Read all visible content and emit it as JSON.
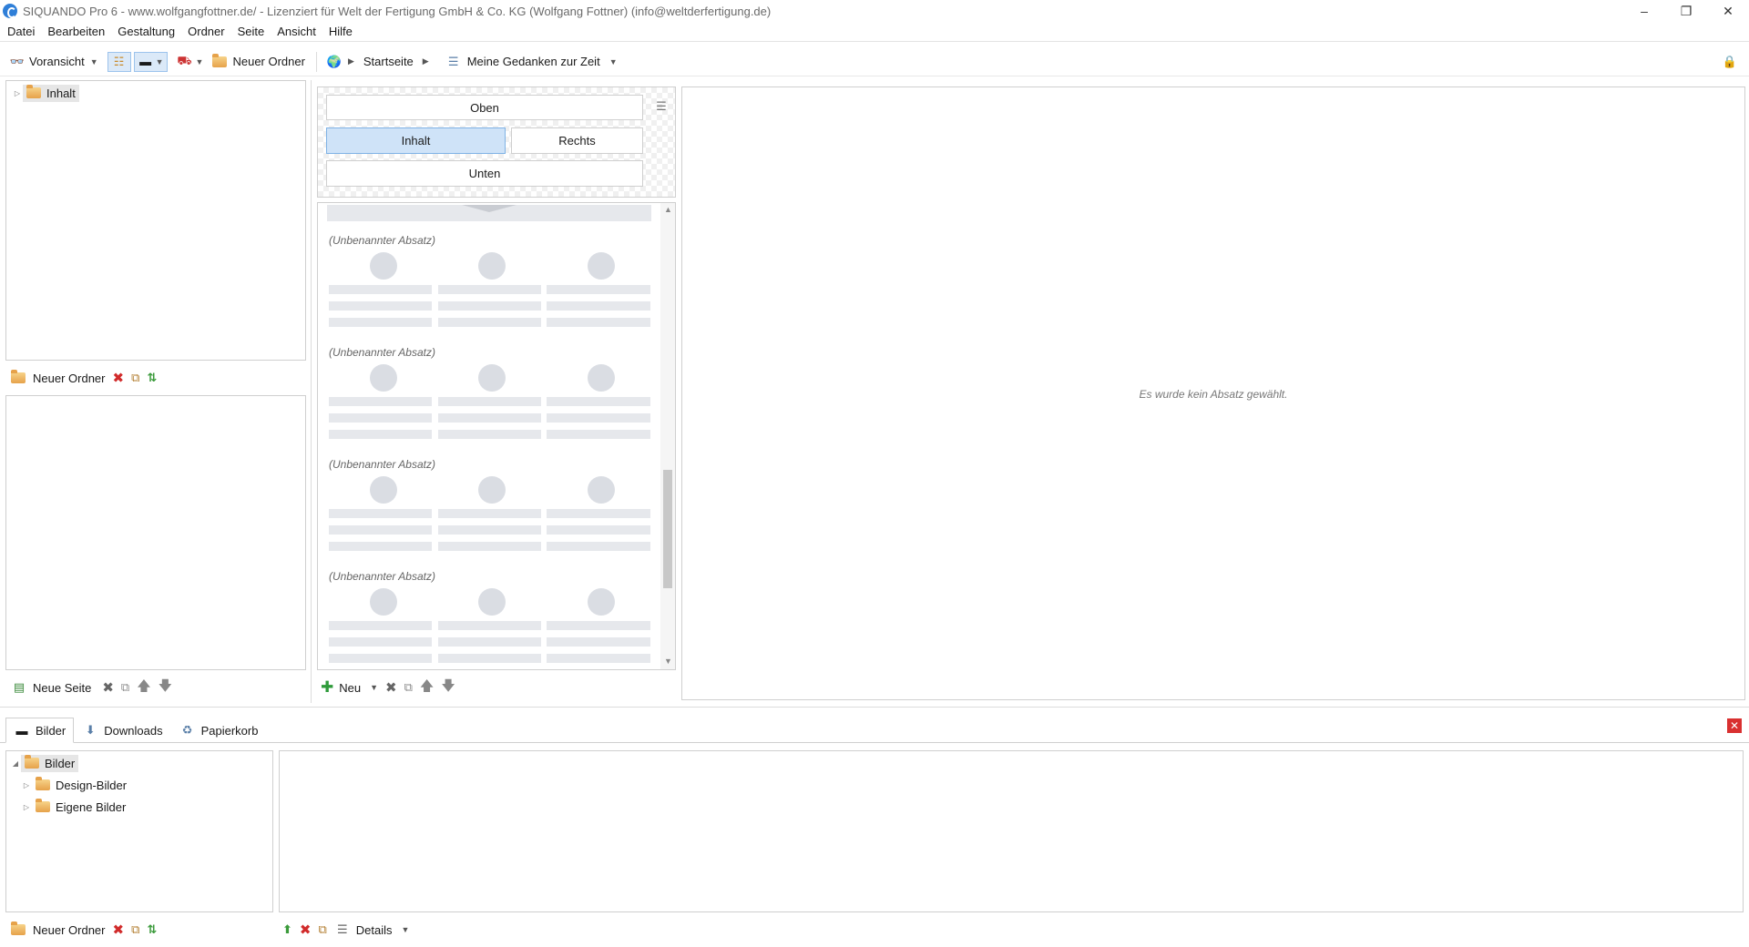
{
  "window": {
    "title": "SIQUANDO Pro 6 - www.wolfgangfottner.de/ - Lizenziert für Welt der Fertigung GmbH & Co. KG (Wolfgang Fottner) (info@weltderfertigung.de)",
    "minimize": "–",
    "maximize": "❐",
    "close": "✕"
  },
  "menu": [
    "Datei",
    "Bearbeiten",
    "Gestaltung",
    "Ordner",
    "Seite",
    "Ansicht",
    "Hilfe"
  ],
  "toolbar": {
    "preview": "Voransicht",
    "new_folder": "Neuer Ordner",
    "breadcrumb_home": "Startseite",
    "breadcrumb_page": "Meine Gedanken zur Zeit"
  },
  "tree": {
    "root": "Inhalt"
  },
  "folder_actions": {
    "new_folder": "Neuer Ordner"
  },
  "page_actions": {
    "new_page": "Neue Seite"
  },
  "layout": {
    "top": "Oben",
    "content": "Inhalt",
    "right": "Rechts",
    "bottom": "Unten"
  },
  "paragraphs": [
    {
      "title": "(Unbenannter Absatz)"
    },
    {
      "title": "(Unbenannter Absatz)"
    },
    {
      "title": "(Unbenannter Absatz)"
    },
    {
      "title": "(Unbenannter Absatz)"
    }
  ],
  "para_actions": {
    "new": "Neu"
  },
  "detail": {
    "empty_message": "Es wurde kein Absatz gewählt."
  },
  "bottom_tabs": [
    "Bilder",
    "Downloads",
    "Papierkorb"
  ],
  "images_tree": {
    "root": "Bilder",
    "children": [
      "Design-Bilder",
      "Eigene Bilder"
    ]
  },
  "images_actions": {
    "new_folder": "Neuer Ordner",
    "view": "Details"
  }
}
